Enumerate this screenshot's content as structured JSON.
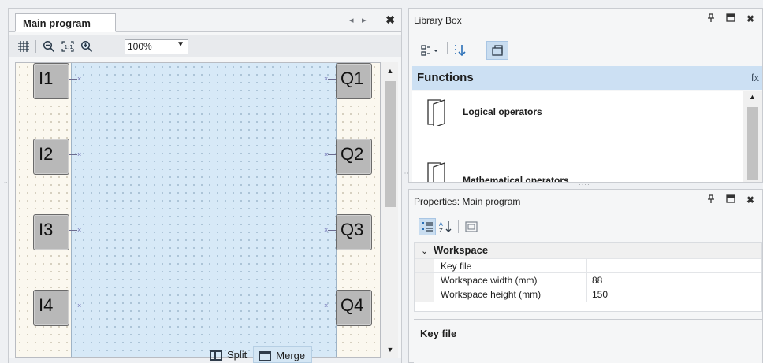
{
  "main_program": {
    "tab_label": "Main program",
    "nav_prev": "◂",
    "nav_next": "▸",
    "close": "✖",
    "toolbar": {
      "grid_icon": "grid-icon",
      "zoom_out_icon": "zoom-out-icon",
      "zoom_reset_icon": "zoom-1to1-icon",
      "zoom_in_icon": "zoom-in-icon",
      "zoom_value": "100%"
    },
    "inputs": [
      "I1",
      "I2",
      "I3",
      "I4"
    ],
    "outputs": [
      "Q1",
      "Q2",
      "Q3",
      "Q4"
    ],
    "split_label": "Split",
    "merge_label": "Merge"
  },
  "library_box": {
    "title": "Library Box",
    "pin": "⮍",
    "maximize": "▬",
    "close": "✖",
    "section": "Functions",
    "section_icon": "fx",
    "items": [
      {
        "label": "Logical operators"
      },
      {
        "label": "Mathematical operators"
      }
    ]
  },
  "properties": {
    "title": "Properties: Main program",
    "category": "Workspace",
    "rows": [
      {
        "name": "Key file",
        "value": ""
      },
      {
        "name": "Workspace width (mm)",
        "value": "88"
      },
      {
        "name": "Workspace height (mm)",
        "value": "150"
      }
    ],
    "description_title": "Key file"
  },
  "colors": {
    "workspace": "#d7e9f7",
    "canvas": "#fbf8ef",
    "io_block": "#b8b8b8",
    "selection": "#cce0f3"
  }
}
